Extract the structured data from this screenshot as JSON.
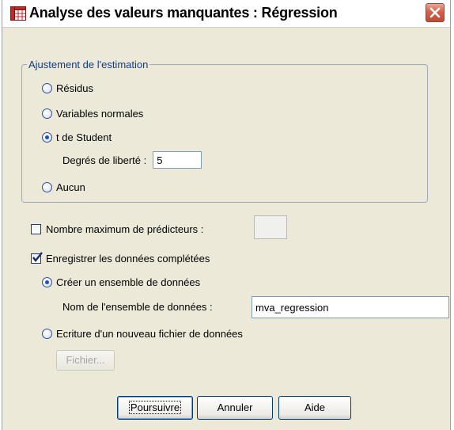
{
  "window": {
    "title": "Analyse des valeurs manquantes : Régression"
  },
  "estimation": {
    "legend": "Ajustement de l'estimation",
    "options": [
      {
        "label": "Résidus",
        "checked": false
      },
      {
        "label": "Variables normales",
        "checked": false
      },
      {
        "label": "t de Student",
        "checked": true
      },
      {
        "label": "Aucun",
        "checked": false
      }
    ],
    "df_label": "Degrés de liberté :",
    "df_value": "5"
  },
  "predictors": {
    "label": "Nombre maximum de prédicteurs :",
    "checked": false,
    "value": ""
  },
  "save": {
    "label": "Enregistrer les données complétées",
    "checked": true,
    "create_dataset_label": "Créer un ensemble de données",
    "create_dataset_checked": true,
    "dataset_name_label": "Nom de l'ensemble de données :",
    "dataset_name_value": "mva_regression",
    "write_file_label": "Ecriture d'un nouveau fichier de données",
    "write_file_checked": false,
    "file_button_label": "Fichier..."
  },
  "buttons": {
    "continue": "Poursuivre",
    "cancel": "Annuler",
    "help": "Aide"
  },
  "colors": {
    "dialog_bg": "#ece9d8",
    "group_label": "#0f3c8c",
    "close_button": "#d4604a"
  }
}
